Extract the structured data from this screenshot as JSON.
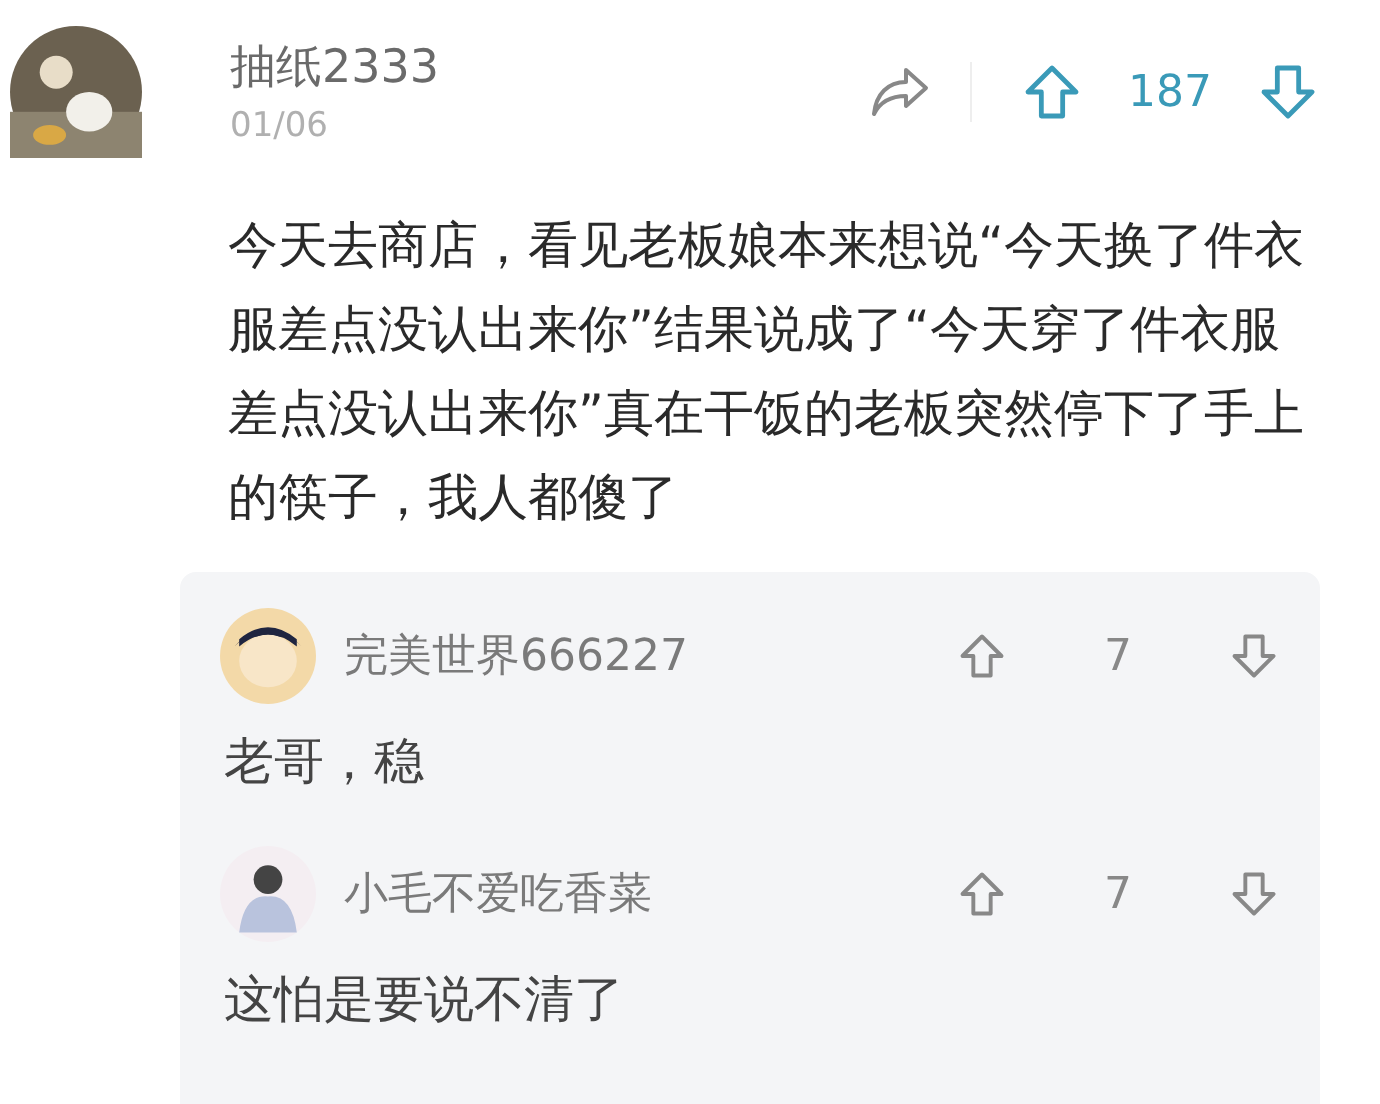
{
  "post": {
    "author": "抽纸2333",
    "date": "01/06",
    "votes": "187",
    "text": "今天去商店，看见老板娘本来想说“今天换了件衣服差点没认出来你”结果说成了“今天穿了件衣服差点没认出来你”真在干饭的老板突然停下了手上的筷子，我人都傻了"
  },
  "replies": [
    {
      "author": "完美世界666227",
      "votes": "7",
      "text": "老哥，稳"
    },
    {
      "author": "小毛不爱吃香菜",
      "votes": "7",
      "text": "这怕是要说不清了"
    }
  ]
}
